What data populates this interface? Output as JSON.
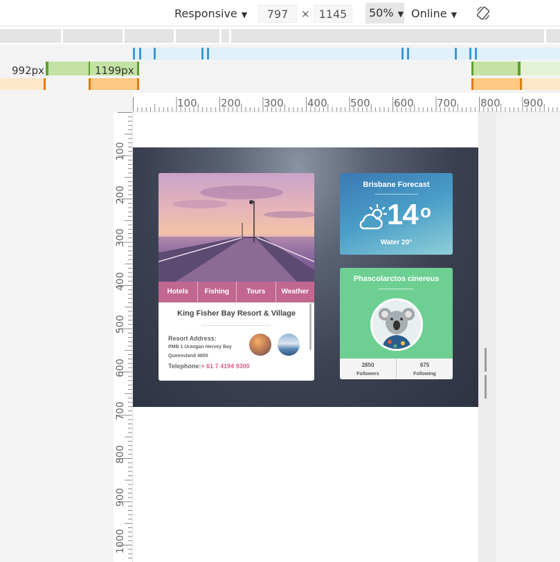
{
  "toolbar": {
    "device": "Responsive",
    "width": "797",
    "times": "×",
    "height": "1145",
    "zoom": "50%",
    "throttle": "Online"
  },
  "media_queries": {
    "min_label": "992px",
    "max_label": "1199px"
  },
  "rulers": {
    "horizontal": [
      "100",
      "200",
      "300",
      "400",
      "500",
      "600",
      "700",
      "800",
      "900"
    ],
    "vertical": [
      "100",
      "200",
      "300",
      "400",
      "500",
      "600",
      "700",
      "800",
      "900",
      "1000"
    ]
  },
  "resort_card": {
    "nav": [
      "Hotels",
      "Fishing",
      "Tours",
      "Weather"
    ],
    "title": "King Fisher Bay Resort & Village",
    "address_label": "Resort Address:",
    "address_line1": "PMB 1 Urangan Hervey Bay",
    "address_line2": "Queensland 4655",
    "telephone_label": "Telephone:",
    "telephone": "+ 61 7 4194 9300"
  },
  "weather_card": {
    "title": "Brisbane Forecast",
    "temperature": "14",
    "degree": "o",
    "water": "Water 20°"
  },
  "profile_card": {
    "name": "Phascolarctos cinereus",
    "followers_count": "2850",
    "followers_label": "Followers",
    "following_count": "675",
    "following_label": "Following"
  },
  "colors": {
    "nav_pink": "#c2678f",
    "profile_green": "#6dcf92",
    "weather_blue": "#4a9ec8",
    "telephone_pink": "#d0608a",
    "hero_dark": "#3b4152"
  },
  "icons": [
    "chevron-down-icon",
    "rotate-icon",
    "partly-cloudy-icon",
    "resize-handle-icon"
  ]
}
